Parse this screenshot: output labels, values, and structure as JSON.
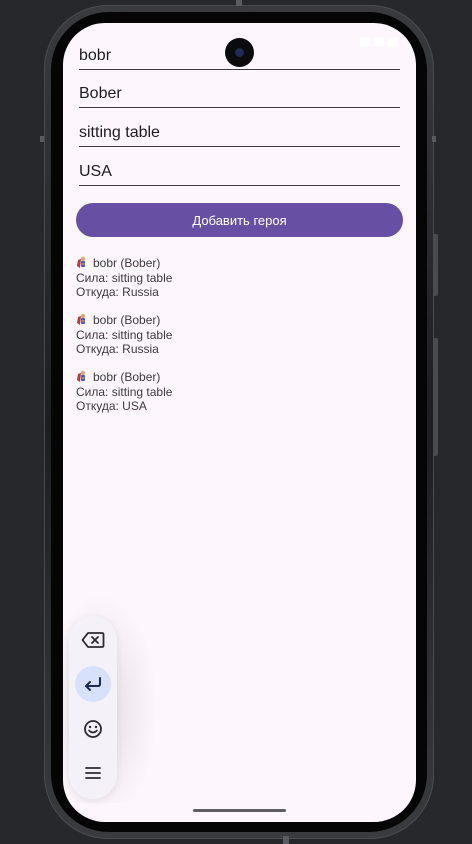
{
  "form": {
    "name_value": "bobr",
    "alias_value": "Bober",
    "power_value": "sitting table",
    "origin_value": "USA",
    "add_button_label": "Добавить героя"
  },
  "heroes": [
    {
      "title": "bobr (Bober)",
      "power": "Сила: sitting table",
      "origin": "Откуда: Russia"
    },
    {
      "title": "bobr (Bober)",
      "power": "Сила: sitting table",
      "origin": "Откуда: Russia"
    },
    {
      "title": "bobr (Bober)",
      "power": "Сила: sitting table",
      "origin": "Откуда: USA"
    }
  ],
  "keyboard_toolbar": {
    "buttons": [
      "backspace-icon",
      "enter-icon",
      "emoji-icon",
      "menu-icon"
    ],
    "active": "enter-icon"
  },
  "colors": {
    "accent": "#6750a4",
    "background": "#fdf6fd",
    "text": "#1c1b1f",
    "active_key": "#d7e1fb"
  }
}
